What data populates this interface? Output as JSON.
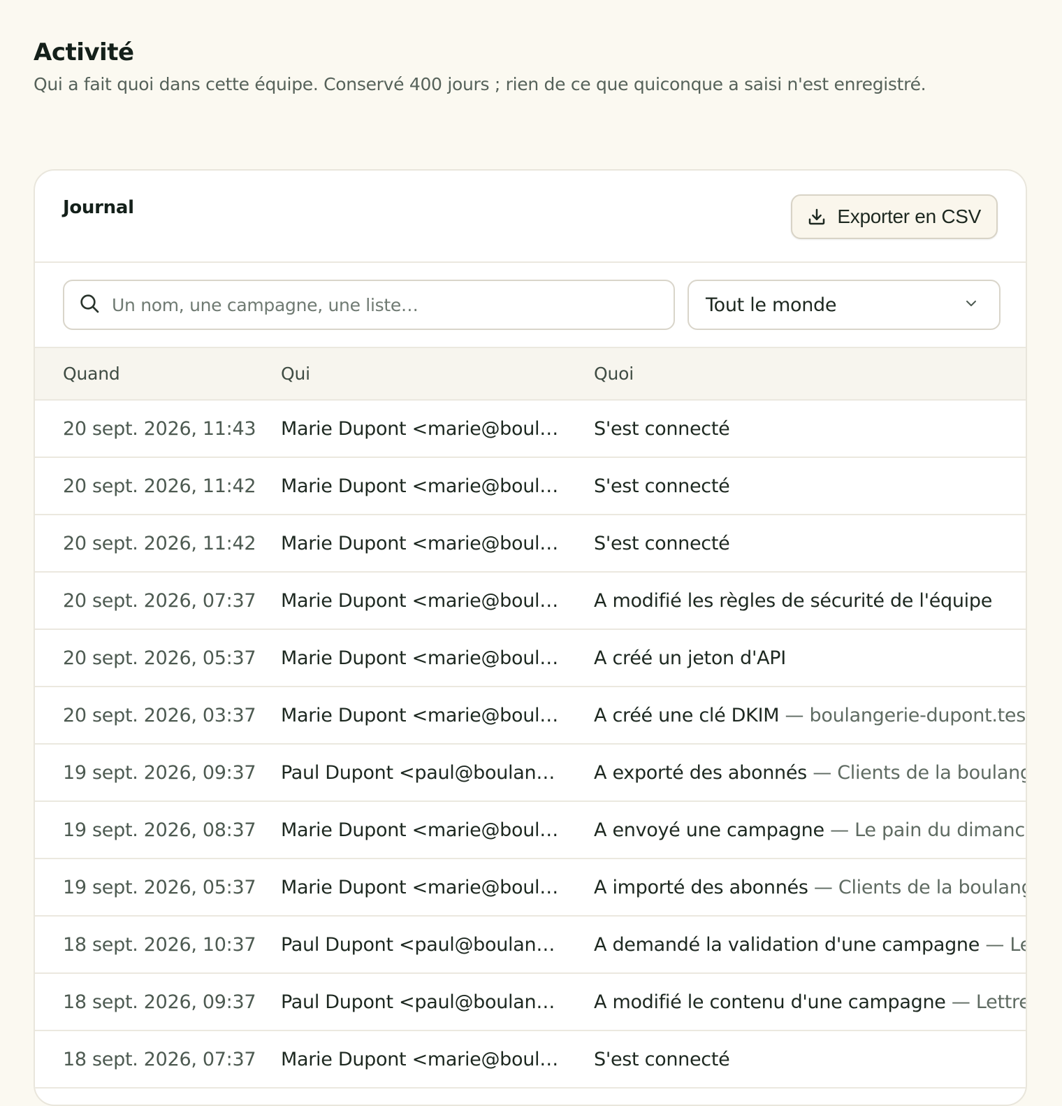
{
  "page": {
    "title": "Activité",
    "subtitle": "Qui a fait quoi dans cette équipe. Conservé 400 jours ; rien de ce que quiconque a saisi n'est enregistré."
  },
  "card": {
    "title": "Journal",
    "export_label": "Exporter en CSV"
  },
  "filters": {
    "search_placeholder": "Un nom, une campagne, une liste…",
    "search_value": "",
    "person_selected": "Tout le monde"
  },
  "table": {
    "headers": {
      "when": "Quand",
      "who": "Qui",
      "what": "Quoi"
    },
    "rows": [
      {
        "when": "20 sept. 2026, 11:43",
        "who": "Marie Dupont <marie@boulangerie-dupont.test>",
        "action": "S'est connecté",
        "detail": ""
      },
      {
        "when": "20 sept. 2026, 11:42",
        "who": "Marie Dupont <marie@boulangerie-dupont.test>",
        "action": "S'est connecté",
        "detail": ""
      },
      {
        "when": "20 sept. 2026, 11:42",
        "who": "Marie Dupont <marie@boulangerie-dupont.test>",
        "action": "S'est connecté",
        "detail": ""
      },
      {
        "when": "20 sept. 2026, 07:37",
        "who": "Marie Dupont <marie@boulangerie-dupont.test>",
        "action": "A modifié les règles de sécurité de l'équipe",
        "detail": ""
      },
      {
        "when": "20 sept. 2026, 05:37",
        "who": "Marie Dupont <marie@boulangerie-dupont.test>",
        "action": "A créé un jeton d'API",
        "detail": ""
      },
      {
        "when": "20 sept. 2026, 03:37",
        "who": "Marie Dupont <marie@boulangerie-dupont.test>",
        "action": "A créé une clé DKIM",
        "detail": "— boulangerie-dupont.test"
      },
      {
        "when": "19 sept. 2026, 09:37",
        "who": "Paul Dupont <paul@boulangerie-dupont.test>",
        "action": "A exporté des abonnés",
        "detail": "— Clients de la boulangerie"
      },
      {
        "when": "19 sept. 2026, 08:37",
        "who": "Marie Dupont <marie@boulangerie-dupont.test>",
        "action": "A envoyé une campagne",
        "detail": "— Le pain du dimanche"
      },
      {
        "when": "19 sept. 2026, 05:37",
        "who": "Marie Dupont <marie@boulangerie-dupont.test>",
        "action": "A importé des abonnés",
        "detail": "— Clients de la boulangerie"
      },
      {
        "when": "18 sept. 2026, 10:37",
        "who": "Paul Dupont <paul@boulangerie-dupont.test>",
        "action": "A demandé la validation d'une campagne",
        "detail": "— Lettre d"
      },
      {
        "when": "18 sept. 2026, 09:37",
        "who": "Paul Dupont <paul@boulangerie-dupont.test>",
        "action": "A modifié le contenu d'une campagne",
        "detail": "— Lettre d"
      },
      {
        "when": "18 sept. 2026, 07:37",
        "who": "Marie Dupont <marie@boulangerie-dupont.test>",
        "action": "S'est connecté",
        "detail": ""
      }
    ]
  },
  "icons": {
    "export": "download-icon",
    "search": "search-icon",
    "select": "chevron-down-icon"
  },
  "colors": {
    "background": "#fbf9f1",
    "text": "#1d2820",
    "muted": "#5f6b62"
  }
}
